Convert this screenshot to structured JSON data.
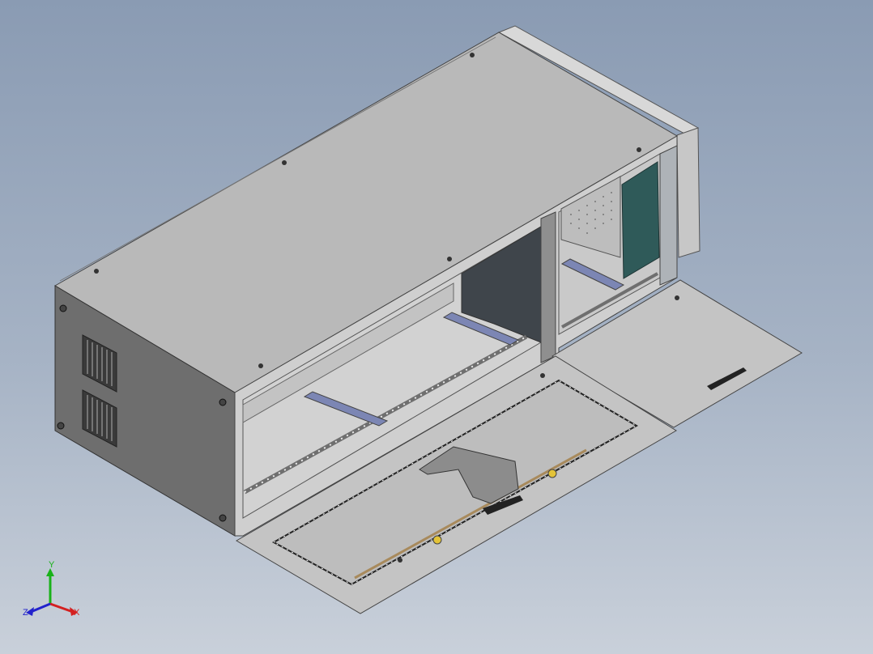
{
  "triad": {
    "x": "X",
    "y": "Y",
    "z": "Z"
  },
  "colors": {
    "background_top": "#8a9bb3",
    "background_bottom": "#c9d0da",
    "enclosure_top": "#b9b9b9",
    "enclosure_side": "#6e6e6e",
    "enclosure_front_frame": "#cfcfcf",
    "interior_dark": "#3f454b",
    "door_panel": "#c4c4c4",
    "pcb_green": "#2f5a59",
    "rail_blue": "#7c86b4",
    "axis_x": "#d42020",
    "axis_y": "#19b219",
    "axis_z": "#2222cc"
  }
}
